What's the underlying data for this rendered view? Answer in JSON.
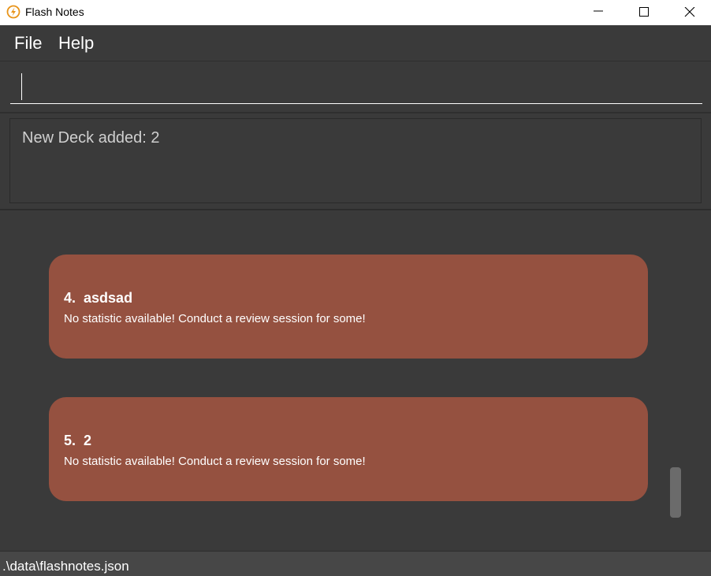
{
  "window": {
    "title": "Flash Notes",
    "icon": "lightning-icon",
    "controls": {
      "minimize": "minimize-icon",
      "maximize": "maximize-icon",
      "close": "close-icon"
    }
  },
  "menu": {
    "items": [
      {
        "label": "File"
      },
      {
        "label": "Help"
      }
    ]
  },
  "command": {
    "value": "",
    "placeholder": ""
  },
  "result": {
    "message": "New Deck added: 2"
  },
  "decks": [
    {
      "index": "4.",
      "name": "asdsad",
      "statistic": "No statistic available! Conduct a review session for some!"
    },
    {
      "index": "5.",
      "name": "2",
      "statistic": "No statistic available! Conduct a review session for some!"
    }
  ],
  "status": {
    "file_path": ".\\data\\flashnotes.json"
  },
  "colors": {
    "background": "#3a3a3a",
    "card": "#955140",
    "status_bar": "#474747",
    "icon_accent": "#e8941a"
  }
}
